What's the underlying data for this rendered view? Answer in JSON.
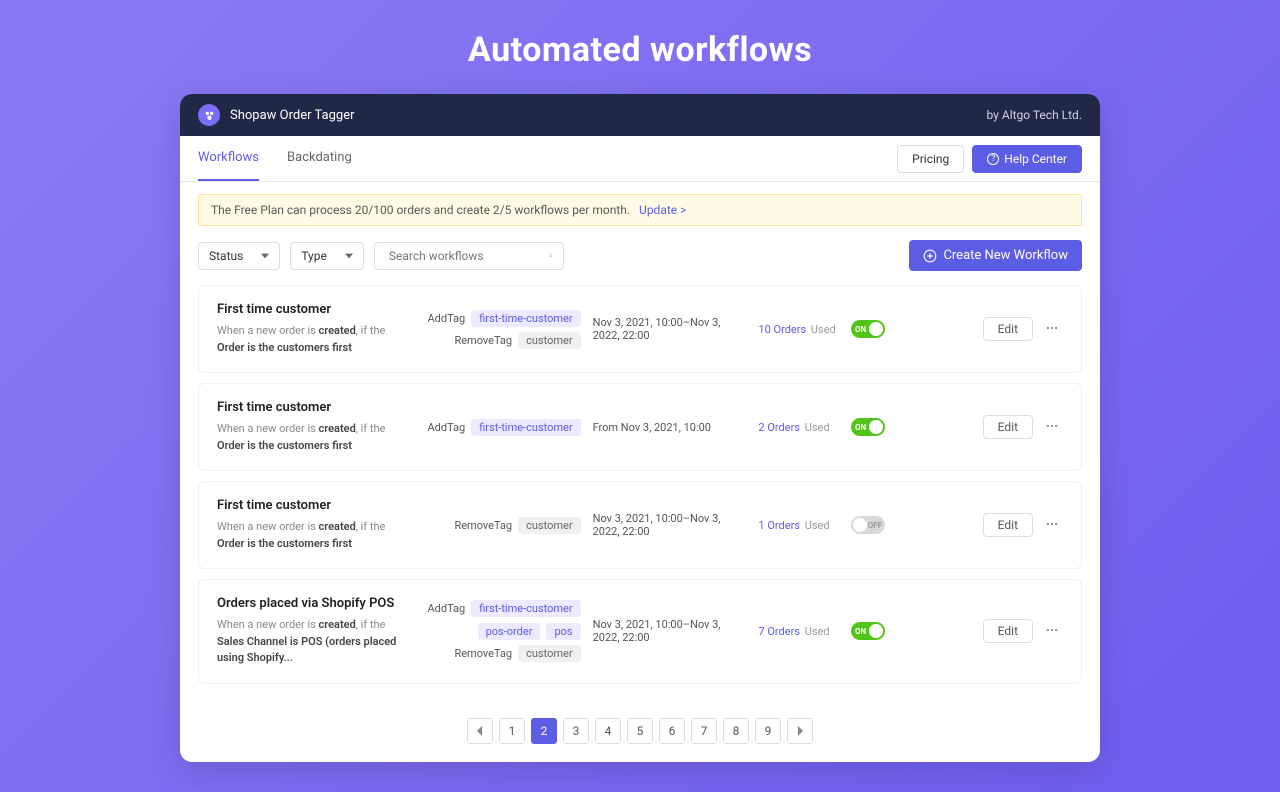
{
  "page_title": "Automated workflows",
  "header": {
    "app_name": "Shopaw Order Tagger",
    "company": "by Altgo Tech Ltd."
  },
  "tabs": [
    {
      "label": "Workflows",
      "active": true
    },
    {
      "label": "Backdating",
      "active": false
    }
  ],
  "nav_actions": {
    "pricing": "Pricing",
    "help": "Help Center"
  },
  "notice": {
    "text": "The Free Plan can process 20/100 orders and create 2/5 workflows per month.",
    "link": "Update >"
  },
  "filters": {
    "status": "Status",
    "type": "Type",
    "search_placeholder": "Search workflows"
  },
  "create_button": "Create New Workflow",
  "workflows": [
    {
      "title": "First time customer",
      "desc_parts": [
        "When a new order is ",
        "created",
        ", if the ",
        "Order is the customers first"
      ],
      "tags": [
        {
          "label": "AddTag",
          "pills": [
            {
              "text": "first-time-customer",
              "style": "purple"
            }
          ]
        },
        {
          "label": "RemoveTag",
          "pills": [
            {
              "text": "customer",
              "style": "gray"
            }
          ]
        }
      ],
      "date": "Nov 3, 2021, 10:00–Nov 3, 2022, 22:00",
      "orders_count": "10",
      "orders_label": "Orders",
      "used_label": "Used",
      "enabled": true
    },
    {
      "title": "First time customer",
      "desc_parts": [
        "When a new order is ",
        "created",
        ", if the ",
        "Order is the customers first"
      ],
      "tags": [
        {
          "label": "AddTag",
          "pills": [
            {
              "text": "first-time-customer",
              "style": "purple"
            }
          ]
        }
      ],
      "date": "From Nov 3, 2021, 10:00",
      "orders_count": "2",
      "orders_label": "Orders",
      "used_label": "Used",
      "enabled": true
    },
    {
      "title": "First time customer",
      "desc_parts": [
        "When a new order is ",
        "created",
        ", if the ",
        "Order is the customers first"
      ],
      "tags": [
        {
          "label": "RemoveTag",
          "pills": [
            {
              "text": "customer",
              "style": "gray"
            }
          ]
        }
      ],
      "date": "Nov 3, 2021, 10:00–Nov 3, 2022, 22:00",
      "orders_count": "1",
      "orders_label": "Orders",
      "used_label": "Used",
      "enabled": false
    },
    {
      "title": "Orders placed via Shopify POS",
      "desc_parts": [
        "When a new order is ",
        "created",
        ", if the ",
        "Sales Channel is POS (orders placed using Shopify..."
      ],
      "tags": [
        {
          "label": "AddTag",
          "pills": [
            {
              "text": "first-time-customer",
              "style": "purple"
            },
            {
              "text": "pos-order",
              "style": "purple"
            },
            {
              "text": "pos",
              "style": "purple"
            }
          ]
        },
        {
          "label": "RemoveTag",
          "pills": [
            {
              "text": "customer",
              "style": "gray"
            }
          ]
        }
      ],
      "date": "Nov 3, 2021, 10:00–Nov 3, 2022, 22:00",
      "orders_count": "7",
      "orders_label": "Orders",
      "used_label": "Used",
      "enabled": true
    }
  ],
  "edit_label": "Edit",
  "pagination": {
    "pages": [
      "1",
      "2",
      "3",
      "4",
      "5",
      "6",
      "7",
      "8",
      "9"
    ],
    "active": "2"
  },
  "toggle_on_text": "ON",
  "toggle_off_text": "OFF"
}
